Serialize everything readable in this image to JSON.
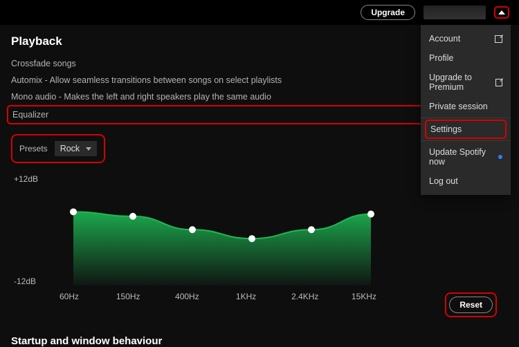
{
  "topbar": {
    "upgrade": "Upgrade"
  },
  "menu": {
    "account": "Account",
    "profile": "Profile",
    "upgrade": "Upgrade to Premium",
    "private": "Private session",
    "settings": "Settings",
    "update": "Update Spotify now",
    "logout": "Log out"
  },
  "section_playback": "Playback",
  "rows": {
    "crossfade": "Crossfade songs",
    "automix": "Automix - Allow seamless transitions between songs on select playlists",
    "mono": "Mono audio - Makes the left and right speakers play the same audio",
    "equalizer": "Equalizer"
  },
  "toggles": {
    "crossfade": false,
    "automix": true,
    "mono": false,
    "equalizer": true
  },
  "presets_label": "Presets",
  "preset_selected": "Rock",
  "db_top": "+12dB",
  "db_bot": "-12dB",
  "freq": [
    "60Hz",
    "150Hz",
    "400Hz",
    "1KHz",
    "2.4KHz",
    "15KHz"
  ],
  "reset": "Reset",
  "section_startup": "Startup and window behaviour",
  "colors": {
    "accent": "#1db954",
    "highlight": "#d80000"
  },
  "chart_data": {
    "type": "line",
    "x": [
      "60Hz",
      "150Hz",
      "400Hz",
      "1KHz",
      "2.4KHz",
      "15KHz"
    ],
    "values_db": [
      4.5,
      3.5,
      0.5,
      -1.5,
      0.5,
      4.0
    ],
    "ylim": [
      -12,
      12
    ],
    "ylabel": "dB",
    "title": "Equalizer"
  }
}
